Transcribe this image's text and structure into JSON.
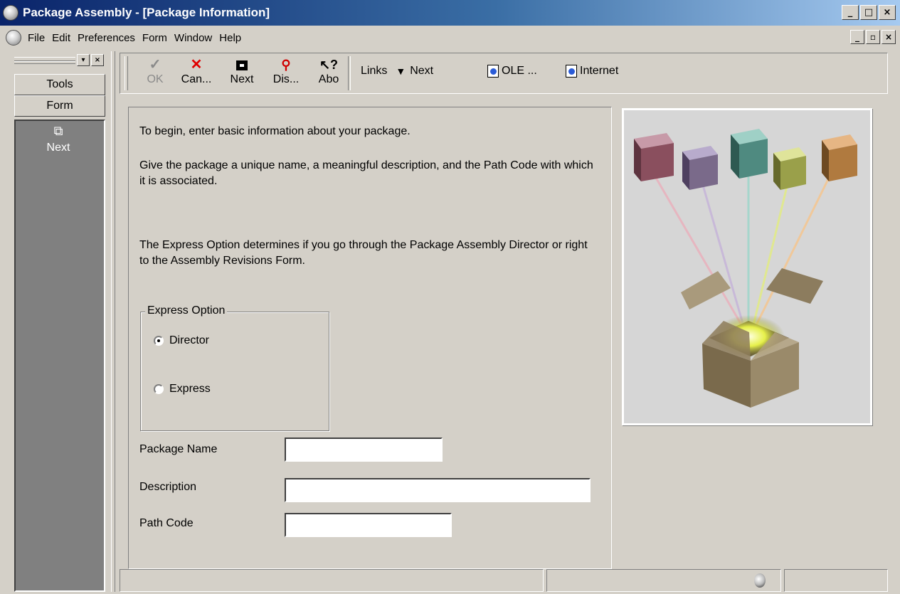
{
  "window": {
    "title": "Package Assembly - [Package Information]",
    "controls": [
      "_",
      "□",
      "×"
    ]
  },
  "menubar": {
    "items": [
      "File",
      "Edit",
      "Preferences",
      "Form",
      "Window",
      "Help"
    ],
    "mdi_controls": [
      "_",
      "▫",
      "×"
    ]
  },
  "left_panel": {
    "tabs": [
      "Tools",
      "Form"
    ],
    "items": [
      {
        "label": "Next",
        "icon": "next-form-icon"
      }
    ]
  },
  "toolbar": {
    "buttons": [
      {
        "label": "OK",
        "icon": "checkmark-icon",
        "enabled": false
      },
      {
        "label": "Can...",
        "icon": "cancel-x-icon",
        "enabled": true
      },
      {
        "label": "Next",
        "icon": "next-icon",
        "enabled": true
      },
      {
        "label": "Dis...",
        "icon": "display-icon",
        "enabled": true
      },
      {
        "label": "Abo",
        "icon": "about-icon",
        "enabled": true
      }
    ],
    "links_label": "Links",
    "links_next": "Next",
    "ole_label": "OLE ...",
    "internet_label": "Internet"
  },
  "main": {
    "intro": "To begin, enter basic information about your package.",
    "instruction": "Give the package a unique name, a meaningful description, and the Path Code with which it is associated.",
    "express_info": "The Express Option determines if you go through the Package Assembly Director or right to the Assembly Revisions Form.",
    "express_group": {
      "legend": "Express Option",
      "options": [
        {
          "label": "Director",
          "selected": true
        },
        {
          "label": "Express",
          "selected": false
        }
      ]
    },
    "fields": {
      "package_name": {
        "label": "Package Name",
        "value": ""
      },
      "description": {
        "label": "Description",
        "value": ""
      },
      "path_code": {
        "label": "Path Code",
        "value": ""
      }
    }
  },
  "illustration": {
    "icon": "package-cubes-illustration",
    "cube_colors": [
      "#8a4f5e",
      "#7a6a8a",
      "#4f8a80",
      "#9aa04a",
      "#b07a3f"
    ]
  }
}
